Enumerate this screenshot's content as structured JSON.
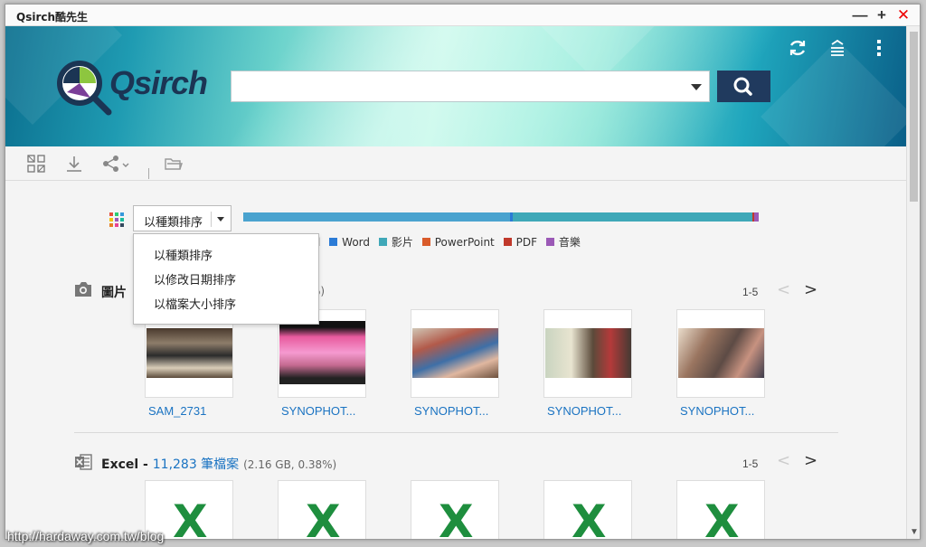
{
  "window": {
    "title": "Qsirch酷先生",
    "minimize": "—",
    "maximize": "+",
    "close": "✕"
  },
  "header": {
    "logo_text": "Qsirch",
    "search": {
      "value": "",
      "placeholder": ""
    },
    "icons": [
      "refresh-icon",
      "storage-icon",
      "more-vertical-icon"
    ]
  },
  "toolbar": {
    "icons": [
      "select-all-icon",
      "download-icon",
      "share-icon",
      "folder-open-icon"
    ]
  },
  "sort": {
    "selected": "以種類排序",
    "options": [
      "以種類排序",
      "以修改日期排序",
      "以檔案大小排序"
    ]
  },
  "legend": [
    {
      "label": "l",
      "color": ""
    },
    {
      "label": "Word",
      "color": "#2b7bd6"
    },
    {
      "label": "影片",
      "color": "#3fa8b8"
    },
    {
      "label": "PowerPoint",
      "color": "#d95b2a"
    },
    {
      "label": "PDF",
      "color": "#c0392b"
    },
    {
      "label": "音樂",
      "color": "#9b59b6"
    }
  ],
  "photos": {
    "title": "圖片",
    "meta_tail": "%)",
    "range": "1-5",
    "prev": "<",
    "next": ">",
    "items": [
      {
        "label": "SAM_2731"
      },
      {
        "label": "SYNOPHOT..."
      },
      {
        "label": "SYNOPHOT..."
      },
      {
        "label": "SYNOPHOT..."
      },
      {
        "label": "SYNOPHOT..."
      }
    ]
  },
  "excel": {
    "title": "Excel - ",
    "count_link": "11,283 筆檔案",
    "meta": "(2.16 GB, 0.38%)",
    "range": "1-5",
    "prev": "<",
    "next": ">",
    "items": [
      "X",
      "X",
      "X",
      "X",
      "X"
    ]
  },
  "watermark": "http://hardaway.com.tw/blog"
}
